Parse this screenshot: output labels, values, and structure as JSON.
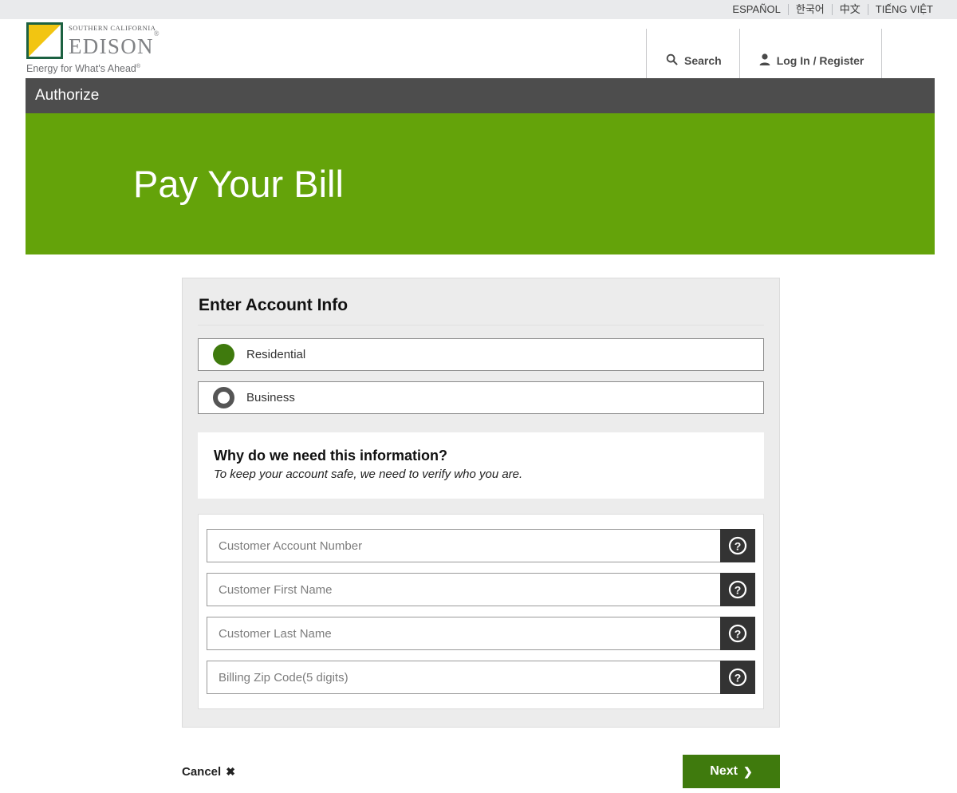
{
  "utility_bar": {
    "languages": [
      {
        "label": "ESPAÑOL"
      },
      {
        "label": "한국어"
      },
      {
        "label": "中文"
      },
      {
        "label": "TIẾNG VIỆT"
      }
    ]
  },
  "header": {
    "logo": {
      "top_line": "SOUTHERN CALIFORNIA",
      "main": "EDISON",
      "registered": "®",
      "tagline": "Energy for What's Ahead",
      "tagline_mark": "®"
    },
    "search_label": "Search",
    "search_icon": "search-icon",
    "account_label": "Log In / Register",
    "account_icon": "user-icon"
  },
  "page": {
    "section_bar_label": "Authorize",
    "hero_title": "Pay Your Bill"
  },
  "form": {
    "title": "Enter Account Info",
    "customer_types": [
      {
        "label": "Residential",
        "selected": true
      },
      {
        "label": "Business",
        "selected": false
      }
    ],
    "info": {
      "heading": "Why do we need this information?",
      "body": "To keep your account safe, we need to verify who you are."
    },
    "fields": [
      {
        "name": "customer-account-number",
        "placeholder": "Customer Account Number",
        "value": "",
        "help_icon": "question-mark-icon"
      },
      {
        "name": "customer-first-name",
        "placeholder": "Customer First Name",
        "value": "",
        "help_icon": "question-mark-icon"
      },
      {
        "name": "customer-last-name",
        "placeholder": "Customer Last Name",
        "value": "",
        "help_icon": "question-mark-icon"
      },
      {
        "name": "billing-zip-code",
        "placeholder": "Billing Zip Code(5 digits)",
        "value": "",
        "help_icon": "question-mark-icon"
      }
    ]
  },
  "actions": {
    "cancel_label": "Cancel",
    "cancel_icon": "✖",
    "next_label": "Next",
    "next_icon": "❯"
  },
  "colors": {
    "hero_green": "#64a30a",
    "button_green": "#3f7a0d",
    "section_bar_gray": "#4d4d4d",
    "card_gray": "#ececec",
    "help_dark": "#333333"
  }
}
